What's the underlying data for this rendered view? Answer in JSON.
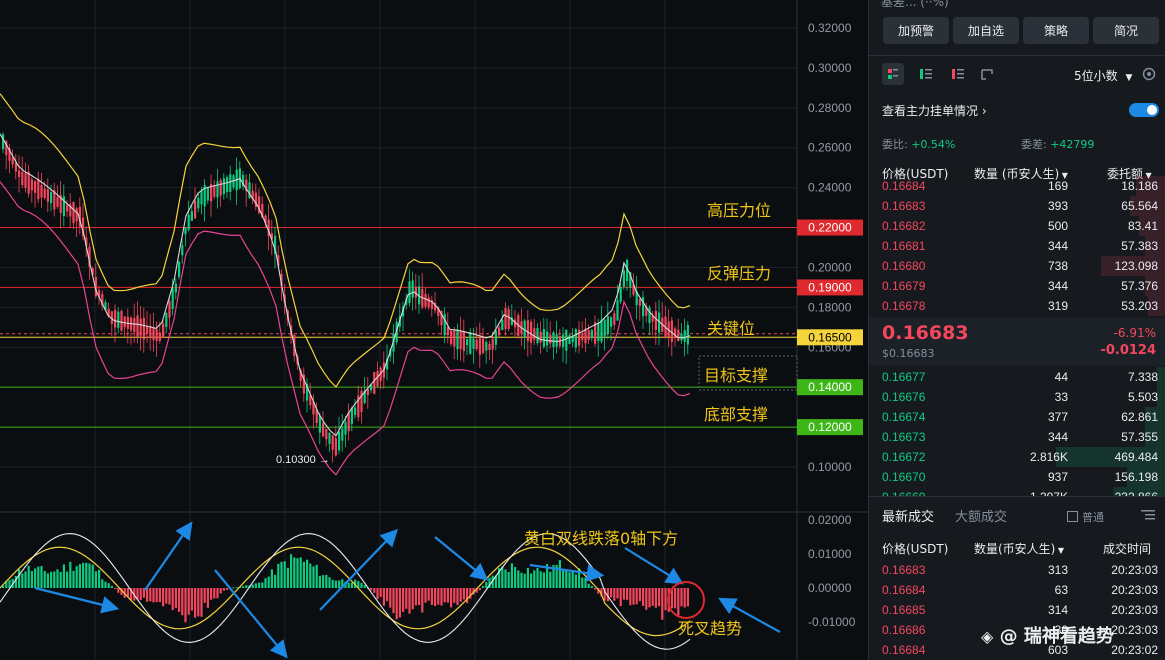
{
  "chart": {
    "y_axis_labels": [
      "0.32000",
      "0.30000",
      "0.28000",
      "0.26000",
      "0.24000",
      "0.20000",
      "0.18000",
      "0.16000",
      "0.10000"
    ],
    "y_axis_values": [
      0.32,
      0.3,
      0.28,
      0.26,
      0.24,
      0.2,
      0.18,
      0.16,
      0.1
    ],
    "price_tags": [
      {
        "label": "0.22000",
        "value": 0.22,
        "color": "#e0292f",
        "text_color": "#ffffff"
      },
      {
        "label": "0.19000",
        "value": 0.19,
        "color": "#e0292f",
        "text_color": "#ffffff"
      },
      {
        "label": "0.16500",
        "value": 0.165,
        "color": "#f5d33b",
        "text_color": "#000000"
      },
      {
        "label": "0.14000",
        "value": 0.14,
        "color": "#3fb618",
        "text_color": "#ffffff"
      },
      {
        "label": "0.12000",
        "value": 0.12,
        "color": "#3fb618",
        "text_color": "#ffffff"
      }
    ],
    "current_price_marker": "0.16500",
    "low_marker": "0.10300 →",
    "macd_axis_labels": [
      "0.02000",
      "0.01000",
      "0.00000",
      "-0.01000"
    ],
    "annotations": {
      "high_pressure": "高压力位",
      "rebound_pressure": "反弹压力",
      "key_level": "关键位",
      "target_support": "目标支撑",
      "bottom_support": "底部支撑",
      "macd_note": "黄白双线跌落0轴下方",
      "death_cross": "死叉趋势"
    },
    "colors": {
      "up": "#0ecb81",
      "down": "#f6465d",
      "upper_band": "#f5d33b",
      "lower_band": "#e84393",
      "mid_band": "#d8d8d8",
      "arrow": "#1e88e5"
    }
  },
  "panel": {
    "top_partial_text": "基差...  (··%)",
    "buttons": [
      "加预警",
      "加自选",
      "策略",
      "简况"
    ],
    "decimals_select": "5位小数",
    "depth_link": "查看主力挂单情况",
    "ratio_label": "委比:",
    "ratio_value": "+0.54%",
    "diff_label": "委差:",
    "diff_value": "+42799",
    "book_headers": {
      "price": "价格(USDT)",
      "qty": "数量 (币安人生)",
      "total": "委托额"
    },
    "asks": [
      {
        "price": "0.16684",
        "qty": "169",
        "total": "18.186",
        "depth": 0.1
      },
      {
        "price": "0.16683",
        "qty": "393",
        "total": "65.564",
        "depth": 0.12
      },
      {
        "price": "0.16682",
        "qty": "500",
        "total": "83.41",
        "depth": 0.09
      },
      {
        "price": "0.16681",
        "qty": "344",
        "total": "57.383",
        "depth": 0.07
      },
      {
        "price": "0.16680",
        "qty": "738",
        "total": "123.098",
        "depth": 0.22
      },
      {
        "price": "0.16679",
        "qty": "344",
        "total": "57.376",
        "depth": 0.07
      },
      {
        "price": "0.16678",
        "qty": "319",
        "total": "53.203",
        "depth": 0.06
      }
    ],
    "last_price": "0.16683",
    "last_price_usd": "$0.16683",
    "change_pct": "-6.91%",
    "change_abs": "-0.0124",
    "bids": [
      {
        "price": "0.16677",
        "qty": "44",
        "total": "7.338",
        "depth": 0.03
      },
      {
        "price": "0.16676",
        "qty": "33",
        "total": "5.503",
        "depth": 0.03
      },
      {
        "price": "0.16674",
        "qty": "377",
        "total": "62.861",
        "depth": 0.07
      },
      {
        "price": "0.16673",
        "qty": "344",
        "total": "57.355",
        "depth": 0.07
      },
      {
        "price": "0.16672",
        "qty": "2.816K",
        "total": "469.484",
        "depth": 0.37
      },
      {
        "price": "0.16670",
        "qty": "937",
        "total": "156.198",
        "depth": 0.13
      },
      {
        "price": "0.16669",
        "qty": "1.397K",
        "total": "232.866",
        "depth": 0.18
      }
    ],
    "trades_tabs": [
      "最新成交",
      "大额成交"
    ],
    "normal_checkbox": "普通",
    "trade_headers": {
      "price": "价格(USDT)",
      "qty": "数量(币安人生)",
      "time": "成交时间"
    },
    "trades": [
      {
        "price": "0.16683",
        "qty": "313",
        "time": "20:23:03"
      },
      {
        "price": "0.16684",
        "qty": "63",
        "time": "20:23:03"
      },
      {
        "price": "0.16685",
        "qty": "314",
        "time": "20:23:03"
      },
      {
        "price": "0.16686",
        "qty": "30",
        "time": "20:23:03"
      },
      {
        "price": "0.16684",
        "qty": "603",
        "time": "20:23:02"
      }
    ],
    "watermark": "@ 瑞神看趋势"
  }
}
